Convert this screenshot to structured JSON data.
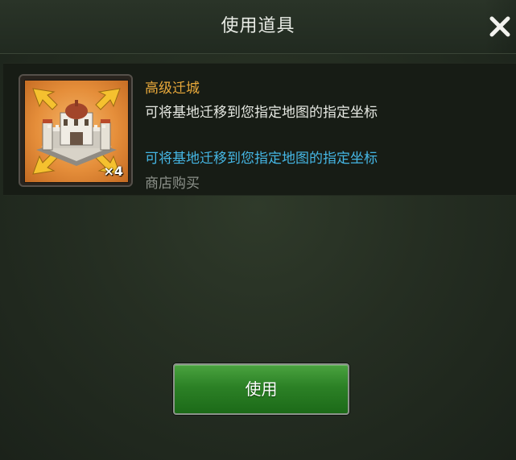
{
  "dialog": {
    "title": "使用道具",
    "close_icon": "close-icon"
  },
  "item": {
    "name": "高级迁城",
    "description": "可将基地迁移到您指定地图的指定坐标",
    "effect": "可将基地迁移到您指定地图的指定坐标",
    "source": "商店购买",
    "quantity": "×4",
    "icon": "castle-relocate-icon"
  },
  "actions": {
    "use_label": "使用"
  },
  "colors": {
    "item_name": "#e9a93b",
    "effect_text": "#45b6e4",
    "source_text": "#8c918a",
    "button_green": "#2c8126"
  }
}
